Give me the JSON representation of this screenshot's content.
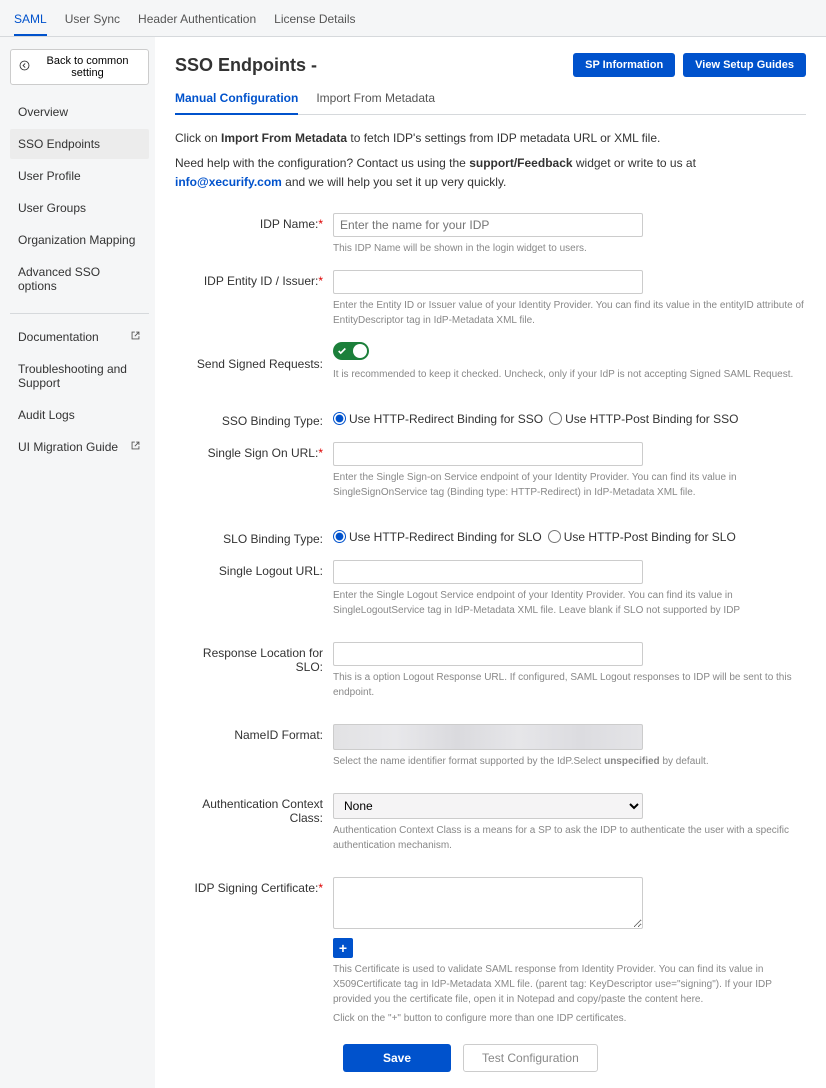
{
  "header_tabs": [
    {
      "label": "SAML",
      "active": true
    },
    {
      "label": "User Sync",
      "active": false
    },
    {
      "label": "Header Authentication",
      "active": false
    },
    {
      "label": "License Details",
      "active": false
    }
  ],
  "sidebar": {
    "back_label": "Back to common setting",
    "items": [
      {
        "label": "Overview",
        "active": false
      },
      {
        "label": "SSO Endpoints",
        "active": true
      },
      {
        "label": "User Profile",
        "active": false
      },
      {
        "label": "User Groups",
        "active": false
      },
      {
        "label": "Organization Mapping",
        "active": false
      },
      {
        "label": "Advanced SSO options",
        "active": false
      }
    ],
    "secondary": [
      {
        "label": "Documentation",
        "external": true
      },
      {
        "label": "Troubleshooting and Support",
        "external": false
      },
      {
        "label": "Audit Logs",
        "external": false
      },
      {
        "label": "UI Migration Guide",
        "external": true
      }
    ]
  },
  "page_title": "SSO Endpoints -",
  "buttons": {
    "sp_info": "SP Information",
    "setup_guides": "View Setup Guides",
    "save": "Save",
    "test": "Test Configuration",
    "add": "+"
  },
  "content_tabs": [
    {
      "label": "Manual Configuration",
      "active": true
    },
    {
      "label": "Import From Metadata",
      "active": false
    }
  ],
  "intro": {
    "line1_prefix": "Click on ",
    "line1_bold": "Import From Metadata",
    "line1_suffix": " to fetch IDP's settings from IDP metadata URL or XML file.",
    "line2_prefix": "Need help with the configuration? Contact us using the ",
    "line2_bold": "support/Feedback",
    "line2_mid": " widget or write to us at ",
    "line2_link": "info@xecurify.com",
    "line2_suffix": " and we will help you set it up very quickly."
  },
  "fields": {
    "idp_name": {
      "label": "IDP Name:",
      "placeholder": "Enter the name for your IDP",
      "hint": "This IDP Name will be shown in the login widget to users."
    },
    "idp_entity": {
      "label": "IDP Entity ID / Issuer:",
      "hint": "Enter the Entity ID or Issuer value of your Identity Provider. You can find its value in the entityID attribute of EntityDescriptor tag in IdP-Metadata XML file."
    },
    "signed_requests": {
      "label": "Send Signed Requests:",
      "hint": "It is recommended to keep it checked. Uncheck, only if your IdP is not accepting Signed SAML Request."
    },
    "sso_binding": {
      "label": "SSO Binding Type:",
      "opt1": "Use HTTP-Redirect Binding for SSO",
      "opt2": "Use HTTP-Post Binding for SSO"
    },
    "sso_url": {
      "label": "Single Sign On URL:",
      "hint": "Enter the Single Sign-on Service endpoint of your Identity Provider. You can find its value in SingleSignOnService tag (Binding type: HTTP-Redirect) in IdP-Metadata XML file."
    },
    "slo_binding": {
      "label": "SLO Binding Type:",
      "opt1": "Use HTTP-Redirect Binding for SLO",
      "opt2": "Use HTTP-Post Binding for SLO"
    },
    "slo_url": {
      "label": "Single Logout URL:",
      "hint": "Enter the Single Logout Service endpoint of your Identity Provider. You can find its value in SingleLogoutService tag in IdP-Metadata XML file. Leave blank if SLO not supported by IDP"
    },
    "response_loc": {
      "label": "Response Location for SLO:",
      "hint": "This is a option Logout Response URL. If configured, SAML Logout responses to IDP will be sent to this endpoint."
    },
    "nameid": {
      "label": "NameID Format:",
      "hint_prefix": "Select the name identifier format supported by the IdP.Select ",
      "hint_bold": "unspecified",
      "hint_suffix": " by default."
    },
    "auth_ctx": {
      "label": "Authentication Context Class:",
      "value": "None",
      "hint": "Authentication Context Class is a means for a SP to ask the IDP to authenticate the user with a specific authentication mechanism."
    },
    "signing_cert": {
      "label": "IDP Signing Certificate:",
      "hint1": "This Certificate is used to validate SAML response from Identity Provider. You can find its value in X509Certificate tag in IdP-Metadata XML file. (parent tag: KeyDescriptor use=\"signing\"). If your IDP provided you the certificate file, open it in Notepad and copy/paste the content here.",
      "hint2": "Click on the \"+\" button to configure more than one IDP certificates."
    }
  }
}
